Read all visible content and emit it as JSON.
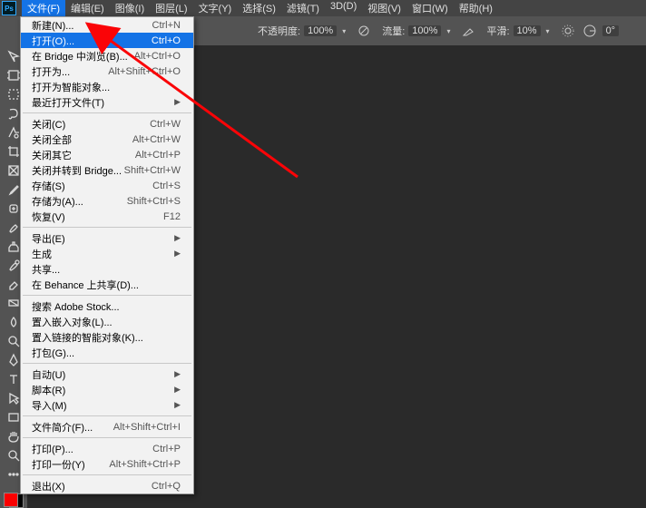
{
  "menubar": {
    "items": [
      "文件(F)",
      "编辑(E)",
      "图像(I)",
      "图层(L)",
      "文字(Y)",
      "选择(S)",
      "滤镜(T)",
      "3D(D)",
      "视图(V)",
      "窗口(W)",
      "帮助(H)"
    ],
    "active_index": 0
  },
  "options_bar": {
    "opacity_label": "不透明度:",
    "opacity_value": "100%",
    "flow_label": "流量:",
    "flow_value": "100%",
    "smooth_label": "平滑:",
    "smooth_value": "10%",
    "angle_icon": "angle-icon",
    "angle_value": "0°"
  },
  "file_menu": {
    "groups": [
      [
        {
          "label": "新建(N)...",
          "shortcut": "Ctrl+N"
        },
        {
          "label": "打开(O)...",
          "shortcut": "Ctrl+O",
          "highlight": true
        },
        {
          "label": "在 Bridge 中浏览(B)...",
          "shortcut": "Alt+Ctrl+O"
        },
        {
          "label": "打开为...",
          "shortcut": "Alt+Shift+Ctrl+O"
        },
        {
          "label": "打开为智能对象..."
        },
        {
          "label": "最近打开文件(T)",
          "submenu": true
        }
      ],
      [
        {
          "label": "关闭(C)",
          "shortcut": "Ctrl+W"
        },
        {
          "label": "关闭全部",
          "shortcut": "Alt+Ctrl+W"
        },
        {
          "label": "关闭其它",
          "shortcut": "Alt+Ctrl+P"
        },
        {
          "label": "关闭并转到 Bridge...",
          "shortcut": "Shift+Ctrl+W"
        },
        {
          "label": "存储(S)",
          "shortcut": "Ctrl+S"
        },
        {
          "label": "存储为(A)...",
          "shortcut": "Shift+Ctrl+S"
        },
        {
          "label": "恢复(V)",
          "shortcut": "F12"
        }
      ],
      [
        {
          "label": "导出(E)",
          "submenu": true
        },
        {
          "label": "生成",
          "submenu": true
        },
        {
          "label": "共享..."
        },
        {
          "label": "在 Behance 上共享(D)..."
        }
      ],
      [
        {
          "label": "搜索 Adobe Stock..."
        },
        {
          "label": "置入嵌入对象(L)..."
        },
        {
          "label": "置入链接的智能对象(K)..."
        },
        {
          "label": "打包(G)..."
        }
      ],
      [
        {
          "label": "自动(U)",
          "submenu": true
        },
        {
          "label": "脚本(R)",
          "submenu": true
        },
        {
          "label": "导入(M)",
          "submenu": true
        }
      ],
      [
        {
          "label": "文件简介(F)...",
          "shortcut": "Alt+Shift+Ctrl+I"
        }
      ],
      [
        {
          "label": "打印(P)...",
          "shortcut": "Ctrl+P"
        },
        {
          "label": "打印一份(Y)",
          "shortcut": "Alt+Shift+Ctrl+P"
        }
      ],
      [
        {
          "label": "退出(X)",
          "shortcut": "Ctrl+Q"
        }
      ]
    ]
  },
  "tools": [
    "move-tool",
    "artboard-tool",
    "marquee-tool",
    "lasso-tool",
    "quick-select-tool",
    "crop-tool",
    "frame-tool",
    "eyedropper-tool",
    "healing-tool",
    "brush-tool",
    "clone-tool",
    "history-brush-tool",
    "eraser-tool",
    "gradient-tool",
    "blur-tool",
    "dodge-tool",
    "pen-tool",
    "type-tool",
    "path-select-tool",
    "rectangle-tool",
    "hand-tool",
    "zoom-tool",
    "edit-toolbar"
  ],
  "colors": {
    "accent": "#1473e6",
    "arrow": "#fa0407"
  }
}
